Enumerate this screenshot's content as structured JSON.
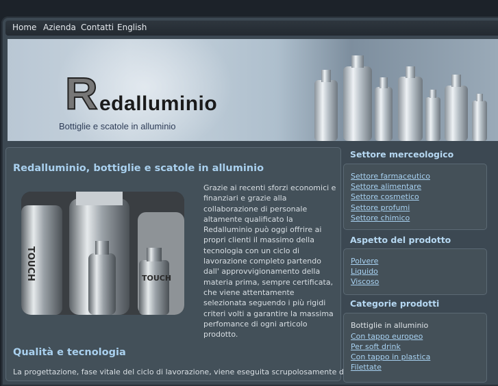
{
  "nav": {
    "items": [
      "Home",
      "Azienda",
      "Contatti",
      "English"
    ]
  },
  "banner": {
    "logo_initial": "R",
    "logo_rest": "edalluminio",
    "tagline": "Bottiglie e scatole in alluminio"
  },
  "main": {
    "heading": "Redalluminio, bottiglie e scatole in alluminio",
    "paragraph": "Grazie ai recenti sforzi economici e finanziari e grazie alla collaborazione di personale altamente qualificato la Redalluminio può oggi offrire ai propri clienti il massimo della tecnologia con un ciclo di lavorazione completo partendo dall' approvvigionamento della materia prima, sempre certificata, che viene attentamente selezionata seguendo i più rigidi criteri volti a garantire la massima perfomance di ogni articolo prodotto.",
    "photo_labels": [
      "TOUCH",
      "TOUCH"
    ],
    "heading2": "Qualità e tecnologia",
    "cut_text": "La progettazione, fase vitale del ciclo di lavorazione, viene eseguita scrupolosamente da"
  },
  "sidebar": {
    "settore": {
      "title": "Settore merceologico",
      "items": [
        "Settore farmaceutico",
        "Settore alimentare",
        "Settore cosmetico",
        "Settore profumi",
        "Settore chimico"
      ]
    },
    "aspetto": {
      "title": "Aspetto del prodotto",
      "items": [
        "Polvere",
        "Liquido",
        "Viscoso"
      ]
    },
    "categorie": {
      "title": "Categorie prodotti",
      "static": "Bottiglie in alluminio",
      "items": [
        "Con tappo europeo",
        "Per soft drink",
        "Con tappo in plastica",
        "Filettate"
      ]
    }
  }
}
